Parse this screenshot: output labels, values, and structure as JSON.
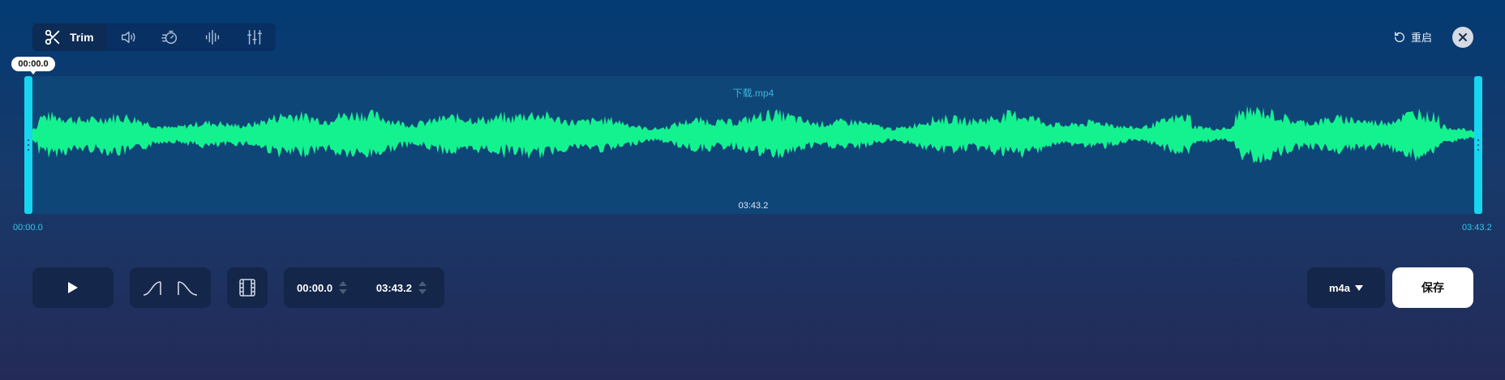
{
  "toolbar": {
    "tools": [
      {
        "label": "Trim",
        "icon": "scissors-icon",
        "active": true
      },
      {
        "icon": "volume-icon"
      },
      {
        "icon": "speed-icon"
      },
      {
        "icon": "equalizer-wave-icon"
      },
      {
        "icon": "mixer-sliders-icon"
      }
    ]
  },
  "header": {
    "reset_label": "重启",
    "reset_icon": "undo-icon",
    "close_icon": "close-icon"
  },
  "waveform": {
    "filename": "下载.mp4",
    "total_duration": "03:43.2",
    "selection_start_bubble": "00:00.0",
    "start_label": "00:00.0",
    "end_label": "03:43.2",
    "color": "#13f28f",
    "background": "#0f4678",
    "handle_color": "#17d6ef"
  },
  "controls": {
    "play_icon": "play-icon",
    "fade_in_icon": "fade-in-icon",
    "fade_out_icon": "fade-out-icon",
    "film_icon": "film-strip-icon",
    "range_start": "00:00.0",
    "range_end": "03:43.2",
    "format": "m4a",
    "save_label": "保存"
  }
}
